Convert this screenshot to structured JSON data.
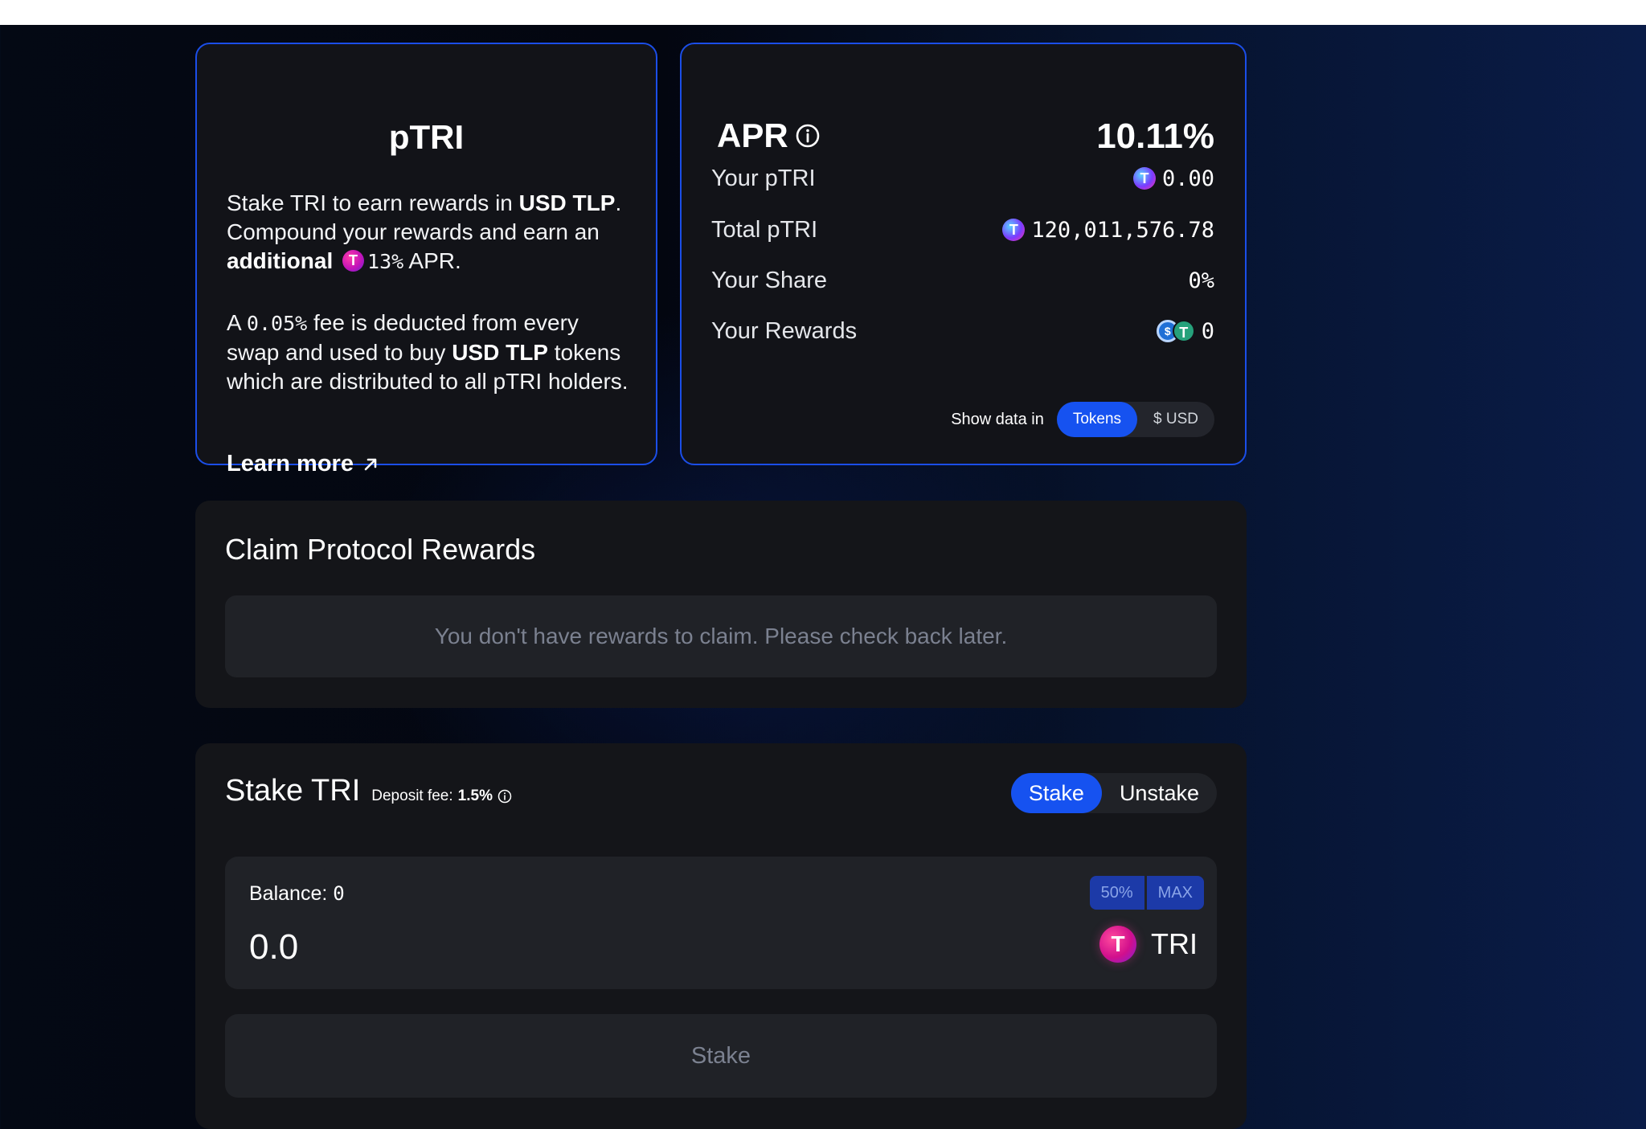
{
  "ptri_card": {
    "title": "pTRI",
    "desc1_a": "Stake TRI to earn rewards in ",
    "desc1_b": "USD TLP",
    "desc1_c": ". Compound your rewards and earn an ",
    "desc1_d": "additional",
    "desc1_e": "13%",
    "desc1_f": " APR.",
    "desc2_a": "A ",
    "desc2_b": "0.05%",
    "desc2_c": " fee is deducted from every swap and used to buy ",
    "desc2_d": "USD TLP",
    "desc2_e": " tokens which are distributed to all pTRI holders.",
    "learn_more": "Learn more",
    "inline_token_icon": "tri-token-icon",
    "link_icon": "arrow-up-right-icon"
  },
  "apr_card": {
    "label": "APR",
    "value": "10.11%",
    "info_icon": "info-icon",
    "rows": [
      {
        "label": "Your pTRI",
        "value": "0.00",
        "icon": "ptri-token-icon"
      },
      {
        "label": "Total pTRI",
        "value": "120,011,576.78",
        "icon": "ptri-token-icon"
      },
      {
        "label": "Your Share",
        "value": "0%"
      },
      {
        "label": "Your Rewards",
        "value": "0",
        "icons": [
          "usdc-token-icon",
          "usdt-token-icon"
        ]
      }
    ],
    "show_data_label": "Show data in",
    "toggle": {
      "tokens": "Tokens",
      "usd": "$ USD",
      "selected": "Tokens"
    }
  },
  "claim": {
    "title": "Claim Protocol Rewards",
    "empty_message": "You don't have rewards to claim. Please check back later."
  },
  "stake": {
    "title": "Stake TRI",
    "deposit_fee_label": "Deposit fee: ",
    "deposit_fee_value": "1.5%",
    "mode": {
      "stake": "Stake",
      "unstake": "Unstake",
      "selected": "Stake"
    },
    "balance_label": "Balance: ",
    "balance_value": "0",
    "pct_50": "50%",
    "pct_max": "MAX",
    "amount_value": "0.0",
    "token": "TRI",
    "submit_label": "Stake"
  },
  "colors": {
    "accent": "#1652f0",
    "card_border": "#1b4ee8",
    "card_bg": "#121318",
    "muted_text": "#7b8190"
  }
}
